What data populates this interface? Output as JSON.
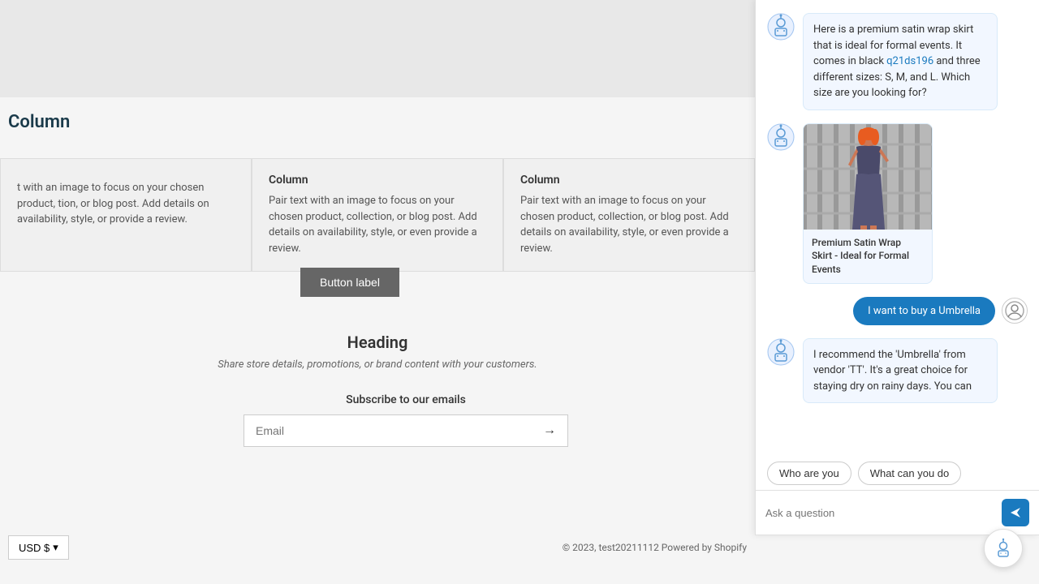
{
  "page": {
    "bg_color": "#f5f5f5"
  },
  "columns": {
    "section_title": "Column",
    "items": [
      {
        "title": "",
        "text": "t with an image to focus on your chosen product, tion, or blog post. Add details on availability, style, or provide a review."
      },
      {
        "title": "Column",
        "text": "Pair text with an image to focus on your chosen product, collection, or blog post. Add details on availability, style, or even provide a review."
      },
      {
        "title": "Column",
        "text": "Pair text with an image to focus on your chosen product, collection, or blog post. Add details on availability, style, or even provide a review."
      }
    ],
    "button_label": "Button label"
  },
  "heading_section": {
    "title": "Heading",
    "subtitle": "Share store details, promotions, or brand content with your customers."
  },
  "subscribe": {
    "label": "Subscribe to our emails",
    "email_placeholder": "Email"
  },
  "footer": {
    "currency": "USD $",
    "copyright": "© 2023, test20211112 Powered by Shopify"
  },
  "chat": {
    "messages": [
      {
        "type": "bot",
        "text": "Here is a premium satin wrap skirt that is ideal for formal events. It comes in black q21ds196 and three different sizes: S, M, and L. Which size are you looking for?"
      },
      {
        "type": "bot_product",
        "product_title": "Premium Satin Wrap Skirt - Ideal for Formal Events"
      },
      {
        "type": "user",
        "text": "I want to buy a Umbrella"
      },
      {
        "type": "bot_partial",
        "text": "I recommend the 'Umbrella' from vendor 'TT'. It's a great choice for staying dry on rainy days. You can"
      }
    ],
    "quick_replies": [
      {
        "label": "Who are you"
      },
      {
        "label": "What can you do"
      }
    ],
    "input_placeholder": "Ask a question",
    "send_icon": "➤"
  }
}
